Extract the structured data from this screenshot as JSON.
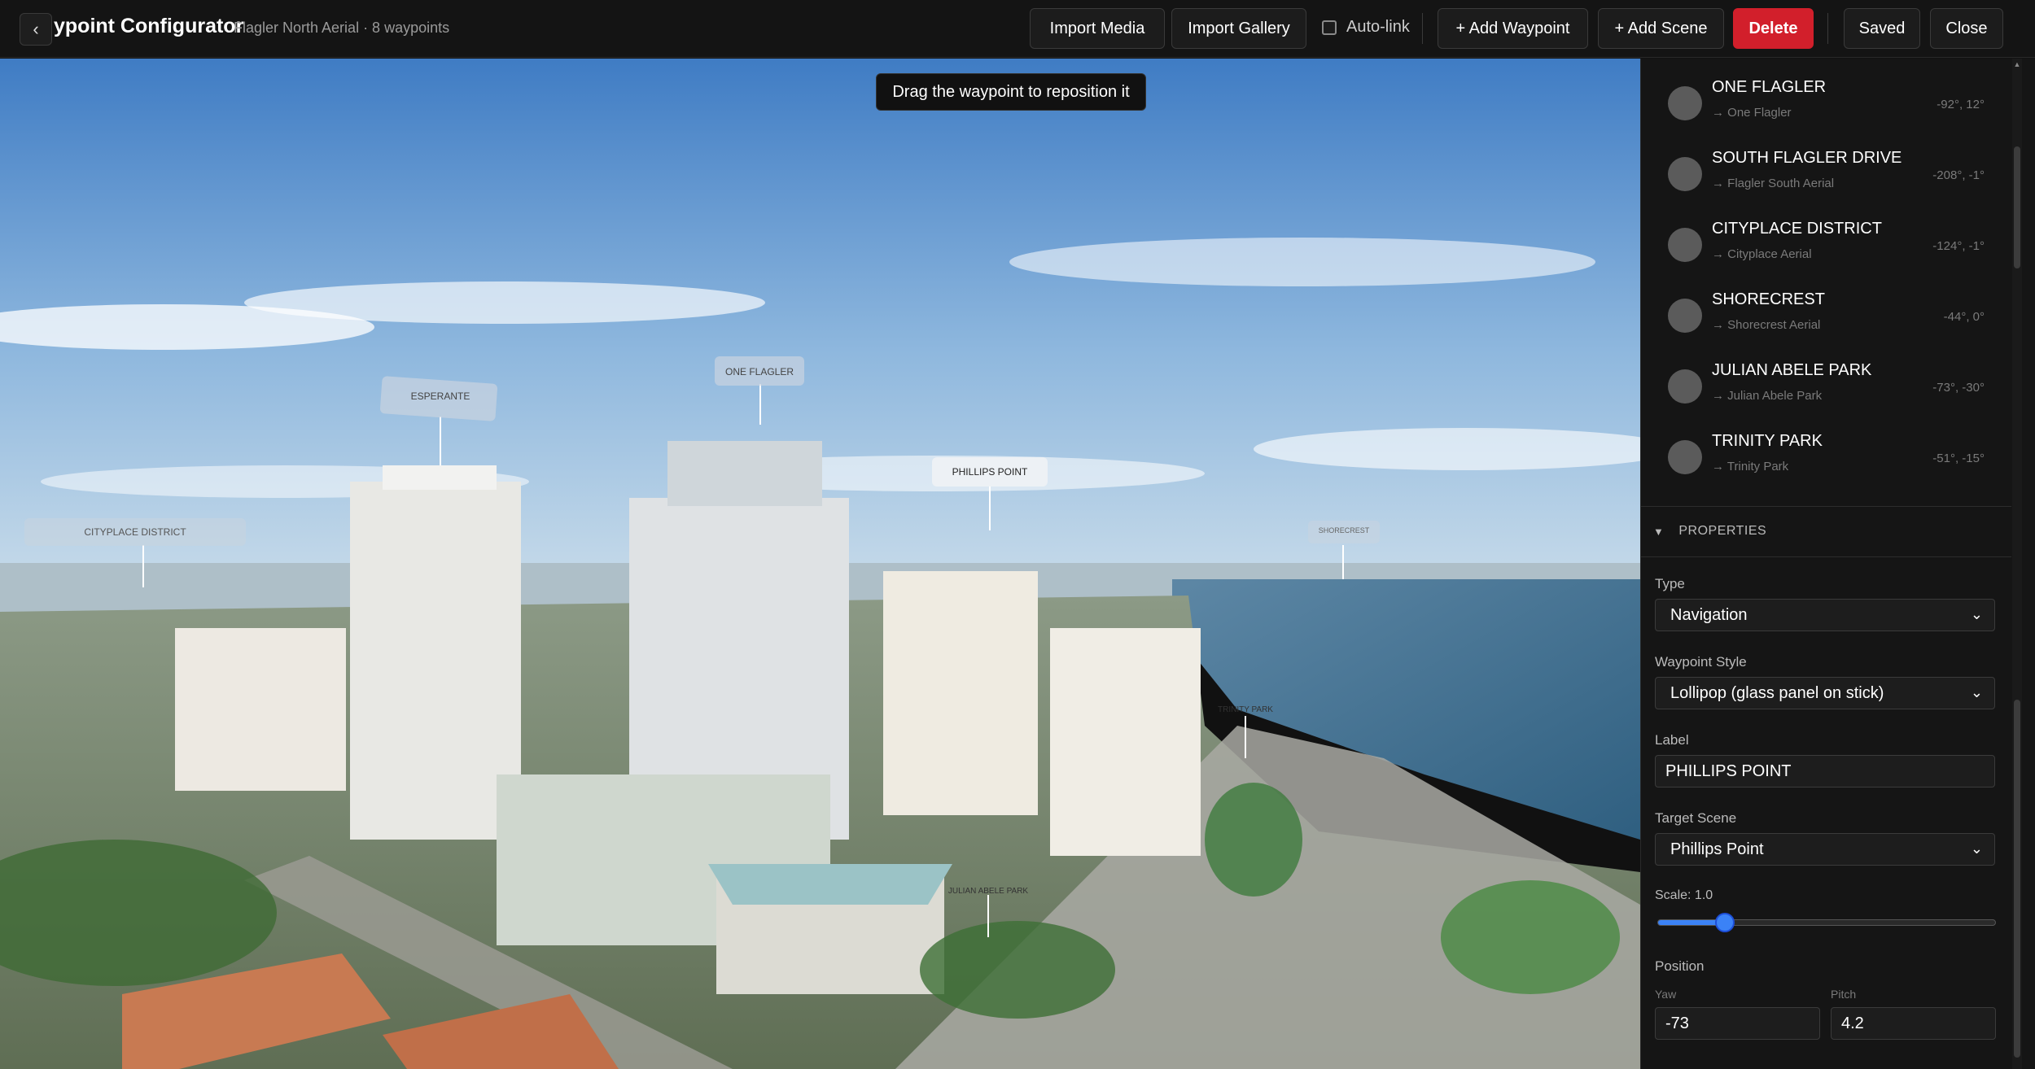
{
  "header": {
    "title": "ypoint Configurator",
    "subtitle": "Flagler North Aerial · 8 waypoints",
    "back_icon": "chevron-left-icon",
    "buttons": {
      "import_media": "Import Media",
      "import_gallery": "Import Gallery",
      "auto_link": "Auto-link",
      "add_waypoint": "+ Add Waypoint",
      "add_scene": "+ Add Scene",
      "delete": "Delete",
      "saved": "Saved",
      "close": "Close"
    },
    "auto_link_checked": false,
    "colors": {
      "delete": "#d21f2b"
    }
  },
  "viewer": {
    "tooltip": "Drag the waypoint to reposition it",
    "waypoint_labels": {
      "esperante": "ESPERANTE",
      "one_flagler": "ONE FLAGLER",
      "phillips_point": "PHILLIPS POINT",
      "cityplace": "CITYPLACE DISTRICT",
      "shorecrest": "SHORECREST",
      "trinity_park": "TRINITY PARK",
      "julian_abele_park": "JULIAN ABELE PARK"
    }
  },
  "waypoints": [
    {
      "name": "ONE FLAGLER",
      "target": "→ One Flagler",
      "coords": "-92°, 12°"
    },
    {
      "name": "SOUTH FLAGLER DRIVE",
      "target": "→ Flagler South Aerial",
      "coords": "-208°, -1°"
    },
    {
      "name": "CITYPLACE DISTRICT",
      "target": "→ Cityplace Aerial",
      "coords": "-124°, -1°"
    },
    {
      "name": "SHORECREST",
      "target": "→ Shorecrest Aerial",
      "coords": "-44°, 0°"
    },
    {
      "name": "JULIAN ABELE PARK",
      "target": "→ Julian Abele Park",
      "coords": "-73°, -30°"
    },
    {
      "name": "TRINITY PARK",
      "target": "→ Trinity Park",
      "coords": "-51°, -15°"
    }
  ],
  "properties": {
    "heading": "PROPERTIES",
    "type_label": "Type",
    "type_value": "Navigation",
    "style_label": "Waypoint Style",
    "style_value": "Lollipop (glass panel on stick)",
    "label_label": "Label",
    "label_value": "PHILLIPS POINT",
    "target_label": "Target Scene",
    "target_value": "Phillips Point",
    "scale_label": "Scale: 1.0",
    "scale_fraction": 0.2,
    "position_label": "Position",
    "yaw_label": "Yaw",
    "yaw_value": "-73",
    "pitch_label": "Pitch",
    "pitch_value": "4.2"
  }
}
